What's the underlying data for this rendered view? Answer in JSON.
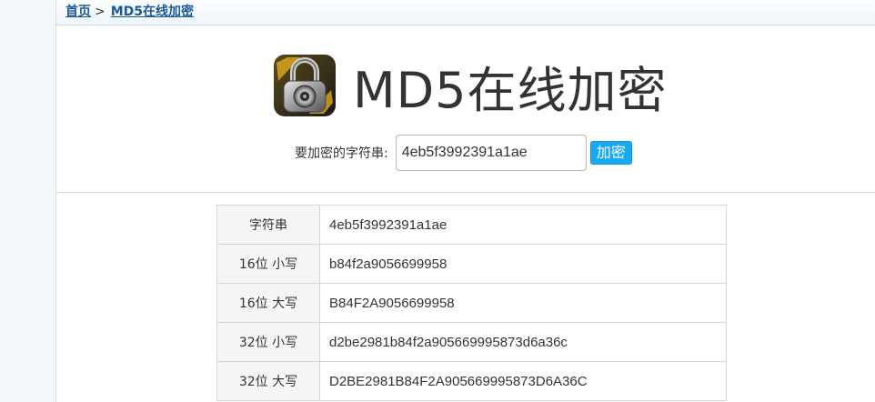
{
  "breadcrumb": {
    "home": "首页",
    "separator": ">",
    "current": "MD5在线加密"
  },
  "header": {
    "icon": "padlock-icon",
    "title": "MD5在线加密"
  },
  "form": {
    "label": "要加密的字符串:",
    "input_value": "4eb5f3992391a1ae",
    "submit_label": "加密"
  },
  "results": {
    "rows": [
      {
        "key": "字符串",
        "value": "4eb5f3992391a1ae"
      },
      {
        "key": "16位 小写",
        "value": "b84f2a9056699958"
      },
      {
        "key": "16位 大写",
        "value": "B84F2A9056699958"
      },
      {
        "key": "32位 小写",
        "value": "d2be2981b84f2a905669995873d6a36c"
      },
      {
        "key": "32位 大写",
        "value": "D2BE2981B84F2A905669995873D6A36C"
      }
    ]
  },
  "colors": {
    "accent": "#18aaf0",
    "link": "#1a5a9a"
  }
}
